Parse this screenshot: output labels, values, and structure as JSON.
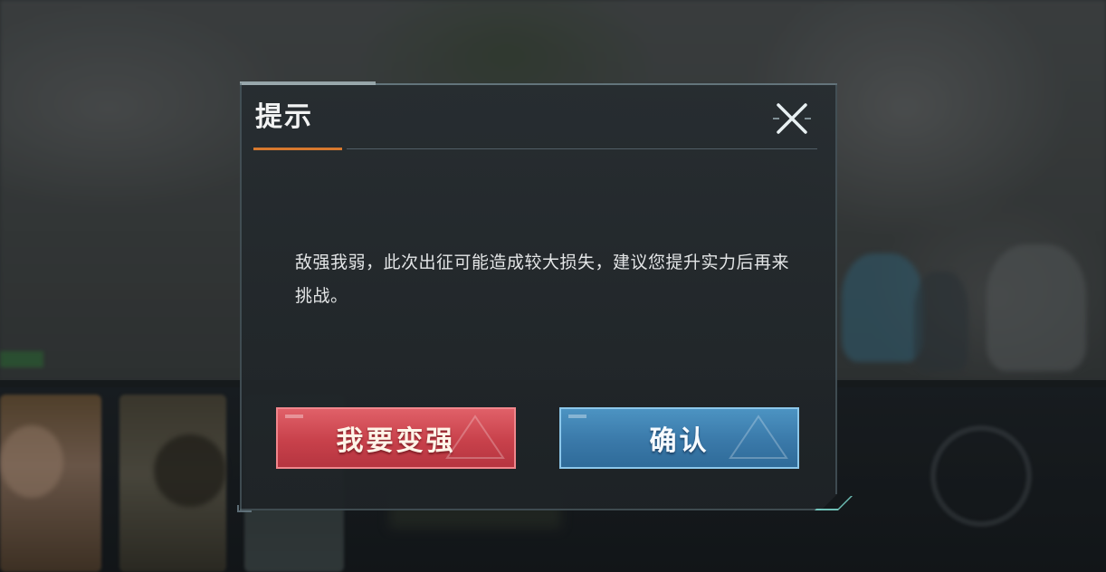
{
  "dialog": {
    "title": "提示",
    "message": "敌强我弱，此次出征可能造成较大损失，建议您提升实力后再来挑战。",
    "close_icon": "close-icon",
    "buttons": {
      "strengthen_label": "我要变强",
      "confirm_label": "确认"
    }
  },
  "colors": {
    "title_accent": "#d7792e",
    "strengthen_button": "#c8414b",
    "confirm_button": "#3a79a9",
    "close_icon": "#e8f0f2",
    "corner_accent": "#78d2c8"
  }
}
